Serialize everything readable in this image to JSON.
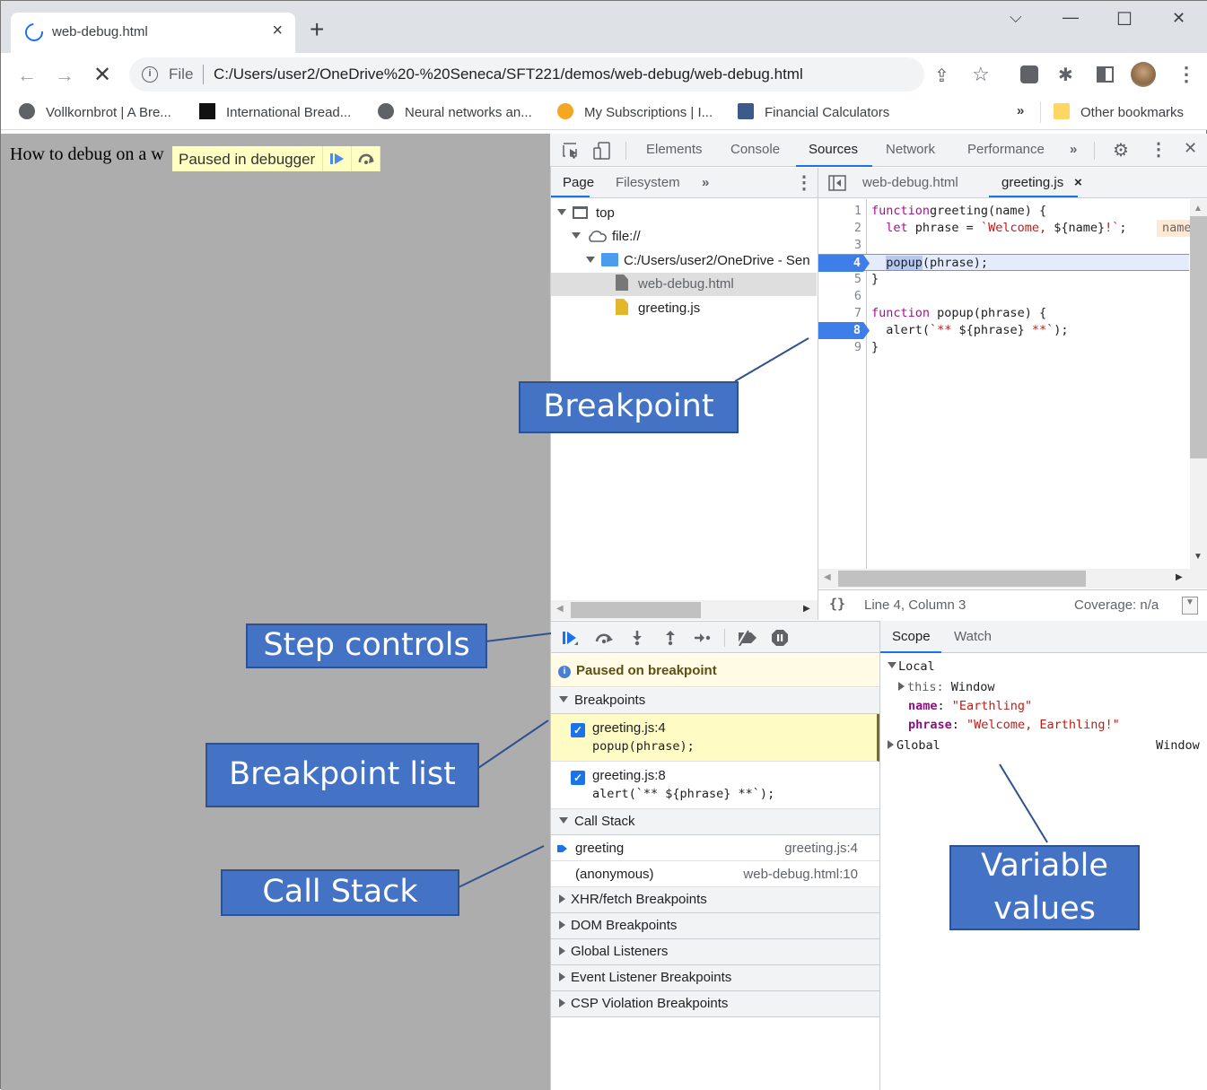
{
  "browser": {
    "tab_title": "web-debug.html",
    "new_tab": "+",
    "window_controls": {
      "dropdown": "⌵",
      "minimize": "—",
      "maximize": "☐",
      "close": "✕"
    },
    "address": {
      "scheme_label": "File",
      "url": "C:/Users/user2/OneDrive%20-%20Seneca/SFT221/demos/web-debug/web-debug.html"
    },
    "bookmarks": [
      {
        "label": "Vollkornbrot | A Bre...",
        "icon": "globe-icon"
      },
      {
        "label": "International Bread...",
        "icon": "document-icon"
      },
      {
        "label": "Neural networks an...",
        "icon": "globe-icon"
      },
      {
        "label": "My Subscriptions | I...",
        "icon": "subscriptions-icon"
      },
      {
        "label": "Financial Calculators",
        "icon": "calculator-icon"
      }
    ],
    "bookmarks_overflow": "»",
    "other_bookmarks": "Other bookmarks"
  },
  "page": {
    "text": "How to debug on a w",
    "paused_overlay": "Paused in debugger"
  },
  "devtools": {
    "main_tabs": [
      "Elements",
      "Console",
      "Sources",
      "Network",
      "Performance"
    ],
    "active_main_tab": "Sources",
    "overflow": "»",
    "navigator_tabs": [
      "Page",
      "Filesystem"
    ],
    "active_navigator_tab": "Page",
    "editor_tabs": [
      {
        "label": "web-debug.html",
        "closable": false
      },
      {
        "label": "greeting.js",
        "closable": true,
        "active": true
      }
    ],
    "tree": [
      {
        "label": "top",
        "icon": "frame-icon"
      },
      {
        "label": "file://",
        "icon": "cloud-icon"
      },
      {
        "label": "C:/Users/user2/OneDrive - Sen",
        "icon": "folder-icon"
      },
      {
        "label": "web-debug.html",
        "icon": "html-file-icon",
        "selected": true
      },
      {
        "label": "greeting.js",
        "icon": "js-file-icon"
      }
    ],
    "code": {
      "lines": [
        {
          "n": "1",
          "parts": [
            [
              "kw",
              "function"
            ],
            [
              "",
              "greeting(name) {"
            ]
          ]
        },
        {
          "n": "2",
          "parts": [
            [
              "",
              "  "
            ],
            [
              "kw",
              "let"
            ],
            [
              "",
              " phrase = "
            ],
            [
              "str",
              "`Welcome, "
            ],
            [
              "",
              "${name}"
            ],
            [
              "str",
              "!`"
            ],
            [
              "",
              ";"
            ]
          ],
          "inline_value": "name"
        },
        {
          "n": "3",
          "parts": []
        },
        {
          "n": "4",
          "parts": [
            [
              "",
              "  popup(phrase);"
            ]
          ],
          "breakpoint": true,
          "execution": true
        },
        {
          "n": "5",
          "parts": [
            [
              "",
              "}"
            ]
          ]
        },
        {
          "n": "6",
          "parts": []
        },
        {
          "n": "7",
          "parts": [
            [
              "kw",
              "function"
            ],
            [
              "",
              " popup(phrase) {"
            ]
          ]
        },
        {
          "n": "8",
          "parts": [
            [
              "",
              "  alert("
            ],
            [
              "str",
              "`** "
            ],
            [
              "",
              "${phrase}"
            ],
            [
              "str",
              " **`"
            ],
            [
              "",
              ");"
            ]
          ],
          "breakpoint": true
        },
        {
          "n": "9",
          "parts": [
            [
              "",
              "}"
            ]
          ]
        }
      ]
    },
    "status": {
      "position": "Line 4, Column 3",
      "coverage": "Coverage: n/a"
    },
    "debugger": {
      "paused_message": "Paused on breakpoint",
      "breakpoints_title": "Breakpoints",
      "breakpoints": [
        {
          "file": "greeting.js:4",
          "code": "popup(phrase);",
          "checked": true,
          "active": true
        },
        {
          "file": "greeting.js:8",
          "code": "alert(`** ${phrase} **`);",
          "checked": true
        }
      ],
      "call_stack_title": "Call Stack",
      "call_stack": [
        {
          "fn": "greeting",
          "loc": "greeting.js:4",
          "current": true
        },
        {
          "fn": "(anonymous)",
          "loc": "web-debug.html:10"
        }
      ],
      "collapsed_sections": [
        "XHR/fetch Breakpoints",
        "DOM Breakpoints",
        "Global Listeners",
        "Event Listener Breakpoints",
        "CSP Violation Breakpoints"
      ]
    },
    "scope": {
      "tabs": [
        "Scope",
        "Watch"
      ],
      "active_tab": "Scope",
      "local_label": "Local",
      "this_label": "this",
      "this_value": "Window",
      "vars": [
        {
          "name": "name",
          "value": "\"Earthling\""
        },
        {
          "name": "phrase",
          "value": "\"Welcome, Earthling!\""
        }
      ],
      "global_label": "Global",
      "global_value": "Window"
    }
  },
  "annotations": {
    "breakpoint": "Breakpoint",
    "step_controls": "Step controls",
    "breakpoint_list": "Breakpoint list",
    "call_stack": "Call Stack",
    "variable_values_1": "Variable",
    "variable_values_2": "values"
  }
}
